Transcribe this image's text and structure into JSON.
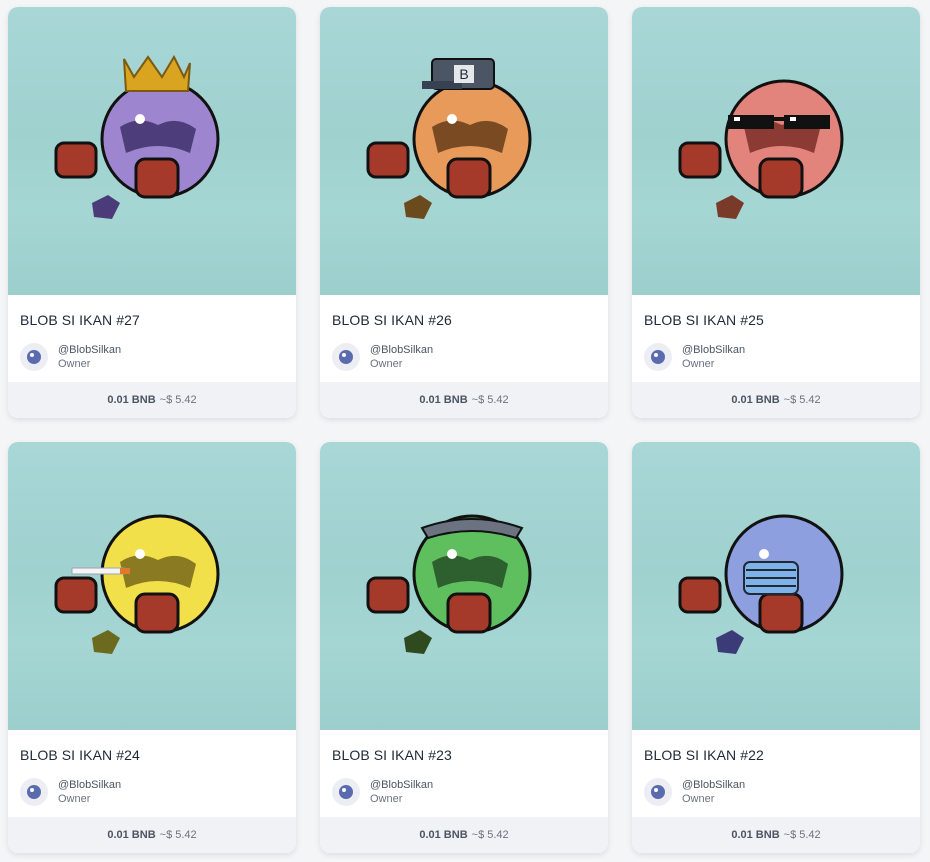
{
  "nfts": [
    {
      "title": "BLOB SI IKAN #27",
      "handle": "@BlobSilkan",
      "role": "Owner",
      "price": "0.01 BNB",
      "fiat": "~$ 5.42",
      "body_color": "#9d86cf",
      "body_dark": "#6d5aa8",
      "accessory": "crown"
    },
    {
      "title": "BLOB SI IKAN #26",
      "handle": "@BlobSilkan",
      "role": "Owner",
      "price": "0.01 BNB",
      "fiat": "~$ 5.42",
      "body_color": "#e79a5a",
      "body_dark": "#b86d35",
      "accessory": "cap"
    },
    {
      "title": "BLOB SI IKAN #25",
      "handle": "@BlobSilkan",
      "role": "Owner",
      "price": "0.01 BNB",
      "fiat": "~$ 5.42",
      "body_color": "#e3847c",
      "body_dark": "#b95a52",
      "accessory": "shades"
    },
    {
      "title": "BLOB SI IKAN #24",
      "handle": "@BlobSilkan",
      "role": "Owner",
      "price": "0.01 BNB",
      "fiat": "~$ 5.42",
      "body_color": "#f2e04a",
      "body_dark": "#c9b52a",
      "accessory": "cigarette"
    },
    {
      "title": "BLOB SI IKAN #23",
      "handle": "@BlobSilkan",
      "role": "Owner",
      "price": "0.01 BNB",
      "fiat": "~$ 5.42",
      "body_color": "#5fbf5f",
      "body_dark": "#3b8c3c",
      "accessory": "beanie"
    },
    {
      "title": "BLOB SI IKAN #22",
      "handle": "@BlobSilkan",
      "role": "Owner",
      "price": "0.01 BNB",
      "fiat": "~$ 5.42",
      "body_color": "#8e9fe0",
      "body_dark": "#5e6fb5",
      "accessory": "mask"
    }
  ]
}
